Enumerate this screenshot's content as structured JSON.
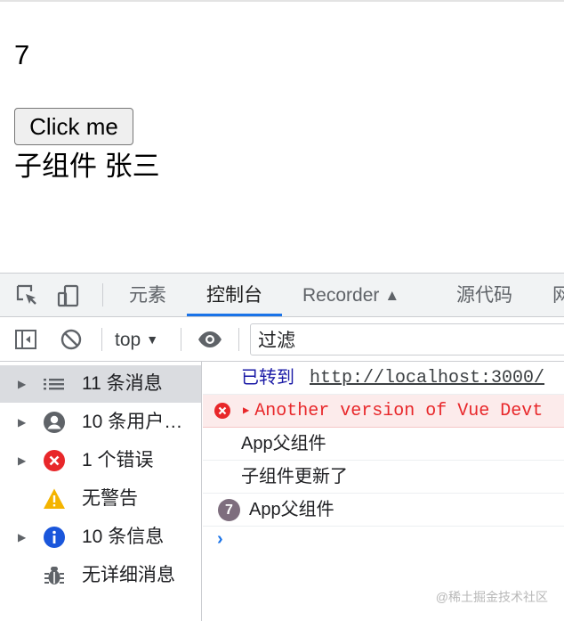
{
  "page": {
    "counter": "7",
    "button_label": "Click me",
    "child_text": "子组件 张三"
  },
  "devtools": {
    "tabs": [
      {
        "label": "元素"
      },
      {
        "label": "控制台",
        "active": true
      },
      {
        "label": "Recorder"
      },
      {
        "label": "源代码"
      },
      {
        "label": "网"
      }
    ],
    "toolbar": {
      "context": "top",
      "filter_value": "过滤"
    },
    "sidebar": {
      "items": [
        {
          "label": "11 条消息",
          "icon": "list-icon"
        },
        {
          "label": "10 条用户…",
          "icon": "user-icon"
        },
        {
          "label": "1 个错误",
          "icon": "error-icon"
        },
        {
          "label": "无警告",
          "icon": "warning-icon"
        },
        {
          "label": "10 条信息",
          "icon": "info-icon"
        },
        {
          "label": "无详细消息",
          "icon": "bug-icon"
        }
      ]
    },
    "console": {
      "nav_prefix": "已转到",
      "nav_url": "http://localhost:3000/",
      "error_text": "Another version of Vue Devt",
      "log1": "App父组件",
      "log2": "子组件更新了",
      "repeat_count": "7",
      "log3": "App父组件",
      "prompt": "›"
    },
    "colors": {
      "accent": "#1a73e8",
      "error": "#e8272a",
      "warning": "#f4b400"
    }
  },
  "watermark": "@稀土掘金技术社区"
}
